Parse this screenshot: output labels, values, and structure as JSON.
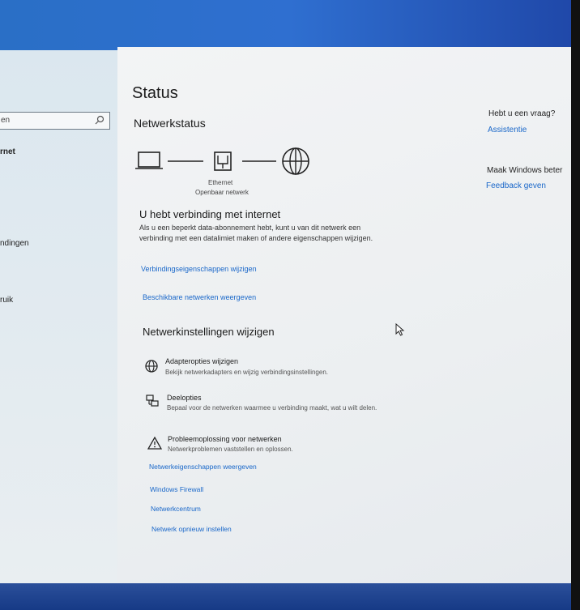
{
  "sidebar": {
    "search_placeholder": "en",
    "items": [
      {
        "label": "rnet",
        "active": true
      },
      {
        "label": "ndingen",
        "active": false
      },
      {
        "label": "ruik",
        "active": false
      }
    ]
  },
  "main": {
    "title": "Status",
    "subtitle": "Netwerkstatus",
    "diagram": {
      "adapter_label": "Ethernet",
      "network_label": "Openbaar netwerk"
    },
    "connection": {
      "heading": "U hebt verbinding met internet",
      "description": "Als u een beperkt data-abonnement hebt, kunt u van dit netwerk een verbinding met een datalimiet maken of andere eigenschappen wijzigen.",
      "change_properties_link": "Verbindingseigenschappen wijzigen",
      "show_networks_link": "Beschikbare netwerken weergeven"
    },
    "change_settings": {
      "heading": "Netwerkinstellingen wijzigen",
      "options": [
        {
          "title": "Adapteropties wijzigen",
          "desc": "Bekijk netwerkadapters en wijzig verbindingsinstellingen.",
          "icon": "adapter-globe-icon"
        },
        {
          "title": "Deelopties",
          "desc": "Bepaal voor de netwerken waarmee u verbinding maakt, wat u wilt delen.",
          "icon": "sharing-computers-icon"
        },
        {
          "title": "Probleemoplossing voor netwerken",
          "desc": "Netwerkproblemen vaststellen en oplossen.",
          "icon": "warning-triangle-icon"
        }
      ],
      "links": [
        "Netwerkeigenschappen weergeven",
        "Windows Firewall",
        "Netwerkcentrum",
        "Netwerk opnieuw instellen"
      ]
    }
  },
  "right_panel": {
    "question": "Hebt u een vraag?",
    "help_link": "Assistentie",
    "improve": "Maak Windows beter",
    "feedback_link": "Feedback geven"
  },
  "colors": {
    "link": "#1967c9",
    "text": "#1b1b1b",
    "pane_bg": "#eff1f2",
    "sidebar_bg": "#dfe8ee"
  }
}
